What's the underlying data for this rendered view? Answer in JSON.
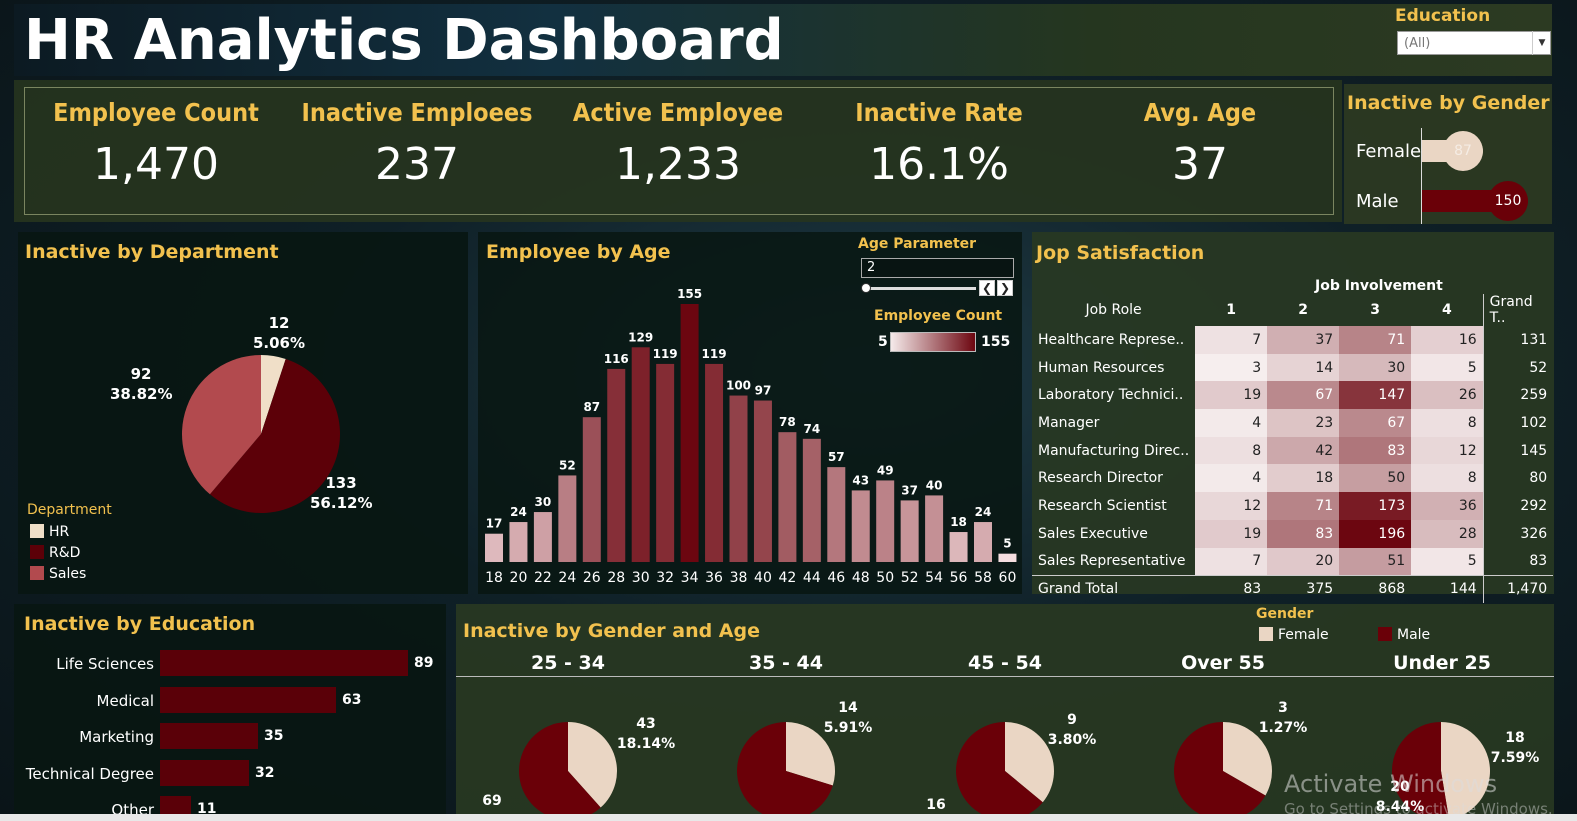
{
  "title": "HR Analytics Dashboard",
  "filter": {
    "label": "Education",
    "value": "(All)"
  },
  "kpis": [
    {
      "label": "Employee Count",
      "value": "1,470"
    },
    {
      "label": "Inactive Emploees",
      "value": "237"
    },
    {
      "label": "Active Employee",
      "value": "1,233"
    },
    {
      "label": "Inactive Rate",
      "value": "16.1%"
    },
    {
      "label": "Avg. Age",
      "value": "37"
    }
  ],
  "gender_panel": {
    "title": "Inactive by Gender",
    "rows": [
      {
        "label": "Female",
        "value": "87",
        "count": 87
      },
      {
        "label": "Male",
        "value": "150",
        "count": 150
      }
    ]
  },
  "department": {
    "title": "Inactive by Department",
    "legend_title": "Department",
    "legend": [
      "HR",
      "R&D",
      "Sales"
    ],
    "labels": [
      {
        "value": "12",
        "pct": "5.06%"
      },
      {
        "value": "133",
        "pct": "56.12%"
      },
      {
        "value": "92",
        "pct": "38.82%"
      }
    ]
  },
  "age_chart": {
    "title": "Employee by Age",
    "param_label": "Age Parameter",
    "param_value": "2",
    "color_legend_label": "Employee Count",
    "color_min": "5",
    "color_max": "155"
  },
  "job_satisfaction": {
    "title": "Jop Satisfaction",
    "col_group": "Job Involvement",
    "row_header": "Job Role",
    "columns": [
      "1",
      "2",
      "3",
      "4"
    ],
    "grand_label": "Grand T..",
    "rows": [
      {
        "role": "Healthcare Represe..",
        "v": [
          "7",
          "37",
          "71",
          "16"
        ],
        "t": "131"
      },
      {
        "role": "Human Resources",
        "v": [
          "3",
          "14",
          "30",
          "5"
        ],
        "t": "52"
      },
      {
        "role": "Laboratory Technici..",
        "v": [
          "19",
          "67",
          "147",
          "26"
        ],
        "t": "259"
      },
      {
        "role": "Manager",
        "v": [
          "4",
          "23",
          "67",
          "8"
        ],
        "t": "102"
      },
      {
        "role": "Manufacturing Direc..",
        "v": [
          "8",
          "42",
          "83",
          "12"
        ],
        "t": "145"
      },
      {
        "role": "Research Director",
        "v": [
          "4",
          "18",
          "50",
          "8"
        ],
        "t": "80"
      },
      {
        "role": "Research Scientist",
        "v": [
          "12",
          "71",
          "173",
          "36"
        ],
        "t": "292"
      },
      {
        "role": "Sales Executive",
        "v": [
          "19",
          "83",
          "196",
          "28"
        ],
        "t": "326"
      },
      {
        "role": "Sales Representative",
        "v": [
          "7",
          "20",
          "51",
          "5"
        ],
        "t": "83"
      }
    ],
    "total": {
      "label": "Grand Total",
      "v": [
        "83",
        "375",
        "868",
        "144"
      ],
      "t": "1,470"
    }
  },
  "education": {
    "title": "Inactive by Education",
    "items": [
      {
        "label": "Life Sciences",
        "value": "89",
        "n": 89
      },
      {
        "label": "Medical",
        "value": "63",
        "n": 63
      },
      {
        "label": "Marketing",
        "value": "35",
        "n": 35
      },
      {
        "label": "Technical Degree",
        "value": "32",
        "n": 32
      },
      {
        "label": "Other",
        "value": "11",
        "n": 11
      }
    ]
  },
  "gender_age": {
    "title": "Inactive by Gender and Age",
    "legend_title": "Gender",
    "legend": [
      "Female",
      "Male"
    ],
    "groups": [
      {
        "label": "25 - 34",
        "female_val": "43",
        "female_pct": "18.14%",
        "male_val": "69"
      },
      {
        "label": "35 - 44",
        "female_val": "14",
        "female_pct": "5.91%",
        "male_val": ""
      },
      {
        "label": "45 - 54",
        "female_val": "9",
        "female_pct": "3.80%",
        "male_val": "16"
      },
      {
        "label": "Over 55",
        "female_val": "3",
        "female_pct": "1.27%",
        "male_val": ""
      },
      {
        "label": "Under 25",
        "female_val": "18",
        "female_pct": "7.59%",
        "male_val": "20",
        "male_pct": "8.44%"
      }
    ]
  },
  "watermark": {
    "line1": "Activate Windows",
    "line2": "Go to Settings to activate Windows."
  },
  "colors": {
    "hr": "#f0dfc8",
    "rnd": "#5c0008",
    "sales": "#b24a4e",
    "accent": "#f2c14e",
    "female": "#ead6c4",
    "male": "#6a0008"
  },
  "chart_data": [
    {
      "type": "bar",
      "title": "Employee by Age",
      "categories": [
        "18",
        "20",
        "22",
        "24",
        "26",
        "28",
        "30",
        "32",
        "34",
        "36",
        "38",
        "40",
        "42",
        "44",
        "46",
        "48",
        "50",
        "52",
        "54",
        "56",
        "58",
        "60"
      ],
      "values": [
        17,
        24,
        30,
        52,
        87,
        116,
        129,
        119,
        155,
        119,
        100,
        97,
        78,
        74,
        57,
        43,
        49,
        37,
        40,
        18,
        24,
        5
      ]
    },
    {
      "type": "pie",
      "title": "Inactive by Department",
      "categories": [
        "HR",
        "R&D",
        "Sales"
      ],
      "values": [
        12,
        133,
        92
      ]
    },
    {
      "type": "bar",
      "title": "Inactive by Education",
      "categories": [
        "Life Sciences",
        "Medical",
        "Marketing",
        "Technical Degree",
        "Other"
      ],
      "values": [
        89,
        63,
        35,
        32,
        11
      ]
    },
    {
      "type": "bar",
      "title": "Inactive by Gender",
      "categories": [
        "Female",
        "Male"
      ],
      "values": [
        87,
        150
      ]
    },
    {
      "type": "pie",
      "title": "Inactive by Gender and Age",
      "categories": [
        "25 - 34",
        "35 - 44",
        "45 - 54",
        "Over 55",
        "Under 25"
      ],
      "series": [
        {
          "name": "Female",
          "values": [
            43,
            14,
            9,
            3,
            18
          ]
        },
        {
          "name": "Male",
          "values": [
            69,
            null,
            16,
            null,
            20
          ]
        }
      ]
    }
  ]
}
